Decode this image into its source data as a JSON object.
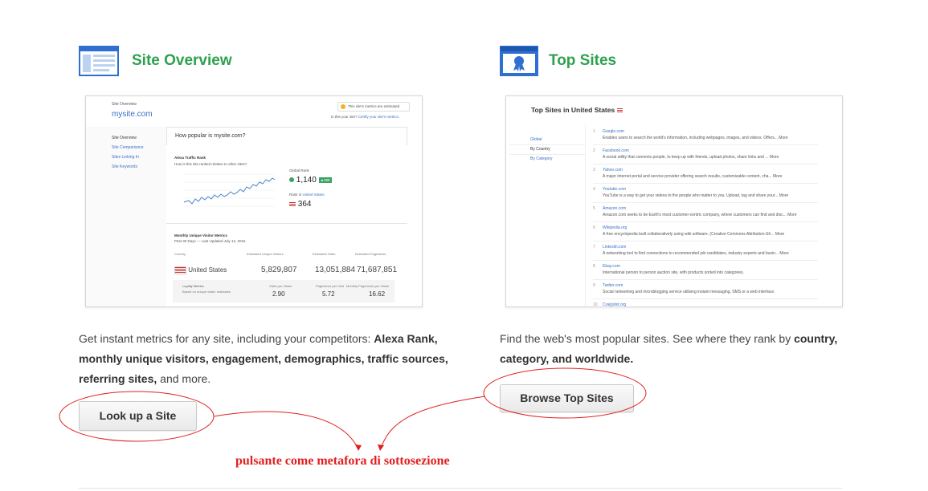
{
  "left": {
    "title": "Site Overview",
    "icon": "browser-window-icon",
    "desc_plain1": "Get instant metrics for any site, including your competitors: ",
    "desc_bold1": "Alexa Rank, monthly unique visitors, engagement, demographics, traffic sources, referring sites,",
    "desc_plain2": " and more.",
    "button": "Look up a Site",
    "thumb": {
      "breadcrumb": "Site Overview",
      "site": "mysite.com",
      "estimated": "This site's metrics are estimated",
      "is_your_site": "Is this your site?",
      "certify": "Certify your site's metrics.",
      "nav": [
        "Site Overview",
        "Site Comparisons",
        "Sites Linking In",
        "Site Keywords"
      ],
      "question": "How popular is mysite.com?",
      "traffic_title": "Alexa Traffic Rank",
      "traffic_sub": "How is this site ranked relative to other sites?",
      "global_label": "Global Rank",
      "global_rank": "1,140",
      "global_change": "▲298",
      "rank_in_label": "Rank in",
      "rank_in_country": "United States",
      "us_rank": "364",
      "visitor_title": "Monthly Unique Visitor Metrics",
      "visitor_sub": "Past 30 Days — Last Updated July 12, 2015",
      "col_country": "Country",
      "col_uv": "Estimated Unique Visitors",
      "col_visits": "Estimated Visits",
      "col_pv": "Estimated Pageviews",
      "country": "United States",
      "uv": "5,829,807",
      "visits": "13,051,884",
      "pv": "71,687,851",
      "loyalty": "Loyalty Metrics",
      "loyalty_sub": "Based on unique visitor estimates",
      "vpv_label": "Visits per Visitor",
      "ppv_label": "Pageviews per Visit",
      "mppv_label": "Monthly Pageviews per Visitor",
      "vpv": "2.90",
      "ppv": "5.72",
      "mppv": "16.62"
    }
  },
  "right": {
    "title": "Top Sites",
    "icon": "award-ribbon-icon",
    "desc_plain1": "Find the web's most popular sites. See where they rank by ",
    "desc_bold1": "country, category, and worldwide.",
    "button": "Browse Top Sites",
    "thumb": {
      "heading": "Top Sites in United States",
      "nav": [
        "Global",
        "By Country",
        "By Category"
      ],
      "sites": [
        {
          "n": "1",
          "name": "Google.com",
          "sum": "Enables users to search the world's information, including webpages, images, and videos. Offers... More"
        },
        {
          "n": "2",
          "name": "Facebook.com",
          "sum": "A social utility that connects people, to keep up with friends, upload photos, share links and ... More"
        },
        {
          "n": "3",
          "name": "Yahoo.com",
          "sum": "A major internet portal and service provider offering search results, customizable content, cha... More"
        },
        {
          "n": "4",
          "name": "Youtube.com",
          "sum": "YouTube is a way to get your videos to the people who matter to you. Upload, tag and share your... More"
        },
        {
          "n": "5",
          "name": "Amazon.com",
          "sum": "Amazon.com seeks to be Earth's most customer-centric company, where customers can find and disc... More"
        },
        {
          "n": "6",
          "name": "Wikipedia.org",
          "sum": "A free encyclopedia built collaboratively using wiki software. (Creative Commons Attribution-Sh... More"
        },
        {
          "n": "7",
          "name": "Linkedin.com",
          "sum": "A networking tool to find connections to recommended job candidates, industry experts and busin... More"
        },
        {
          "n": "8",
          "name": "Ebay.com",
          "sum": "International person to person auction site, with products sorted into categories."
        },
        {
          "n": "9",
          "name": "Twitter.com",
          "sum": "Social networking and microblogging service utilising instant messaging, SMS or a web interface."
        },
        {
          "n": "10",
          "name": "Craigslist.org",
          "sum": ""
        }
      ]
    }
  },
  "annotation": "pulsante come metafora di sottosezione",
  "colors": {
    "title_green": "#2da14e",
    "icon_blue": "#2f6fd0",
    "annotation_red": "#e02020"
  }
}
